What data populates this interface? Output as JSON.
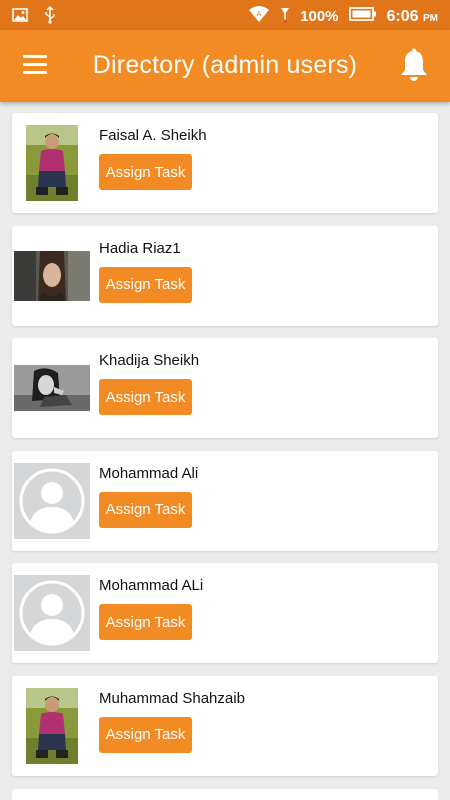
{
  "status_bar": {
    "battery_percent": "100%",
    "time": "6:06",
    "ampm": "PM"
  },
  "app_bar": {
    "title": "Directory (admin users)",
    "menu_icon": "hamburger-menu-icon",
    "bell_icon": "notification-bell-icon"
  },
  "colors": {
    "status_bar": "#e0751a",
    "app_bar": "#f28b24",
    "button": "#f28b24",
    "background": "#ebebeb"
  },
  "users": [
    {
      "name": "Faisal A. Sheikh",
      "button_label": "Assign Task",
      "avatar": "photo-man-outdoor"
    },
    {
      "name": "Hadia Riaz1",
      "button_label": "Assign Task",
      "avatar": "photo-woman"
    },
    {
      "name": "Khadija Sheikh",
      "button_label": "Assign Task",
      "avatar": "photo-woman-bw"
    },
    {
      "name": "Mohammad Ali",
      "button_label": "Assign Task",
      "avatar": "default-avatar"
    },
    {
      "name": "Mohammad ALi",
      "button_label": "Assign Task",
      "avatar": "default-avatar"
    },
    {
      "name": "Muhammad Shahzaib",
      "button_label": "Assign Task",
      "avatar": "photo-man-outdoor"
    }
  ]
}
